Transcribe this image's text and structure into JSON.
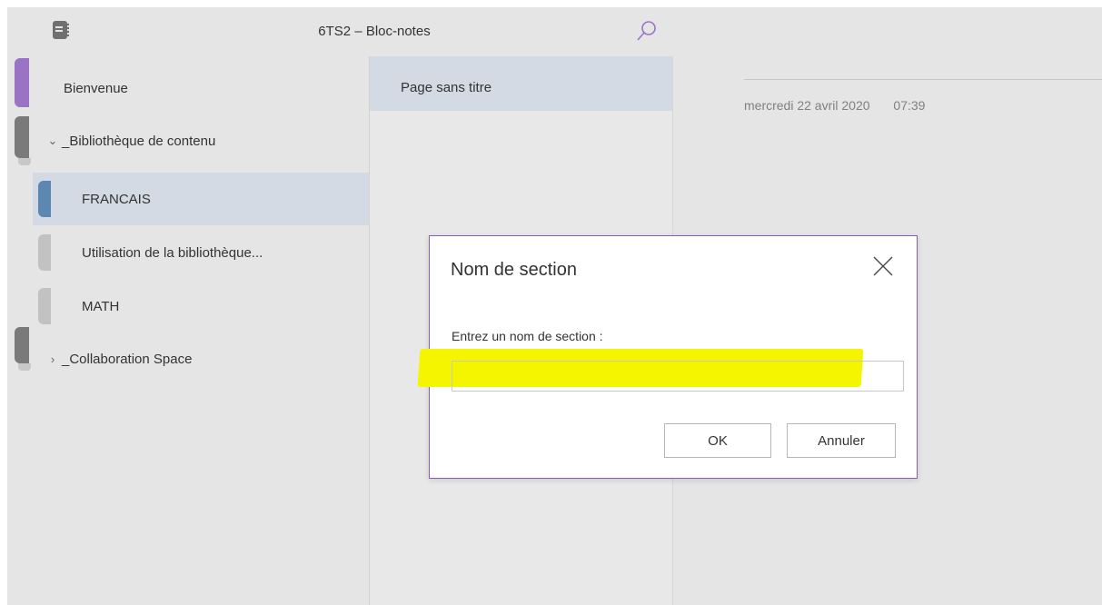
{
  "header": {
    "title": "6TS2 – Bloc-notes"
  },
  "sections": {
    "items": [
      {
        "label": "Bienvenue"
      },
      {
        "label": "_Bibliothèque de contenu",
        "chevron": "⌄"
      },
      {
        "label": "FRANCAIS"
      },
      {
        "label": "Utilisation de la bibliothèque..."
      },
      {
        "label": "MATH"
      },
      {
        "label": "_Collaboration Space",
        "chevron": "›"
      }
    ]
  },
  "pages": {
    "items": [
      {
        "label": "Page sans titre"
      }
    ]
  },
  "content": {
    "date": "mercredi 22 avril 2020",
    "time": "07:39"
  },
  "dialog": {
    "title": "Nom de section",
    "field_label": "Entrez un nom de section :",
    "input_value": "",
    "ok_label": "OK",
    "cancel_label": "Annuler"
  },
  "colors": {
    "accent": "#8b5cb5",
    "notebook_tab": "#9b73c4",
    "section_tab_active": "#5b87b0",
    "selection_bg": "#d3dae3",
    "highlight": "#f5f500"
  },
  "icons": {
    "notebook": "notebook-icon",
    "search": "search-icon",
    "close": "close-icon"
  }
}
